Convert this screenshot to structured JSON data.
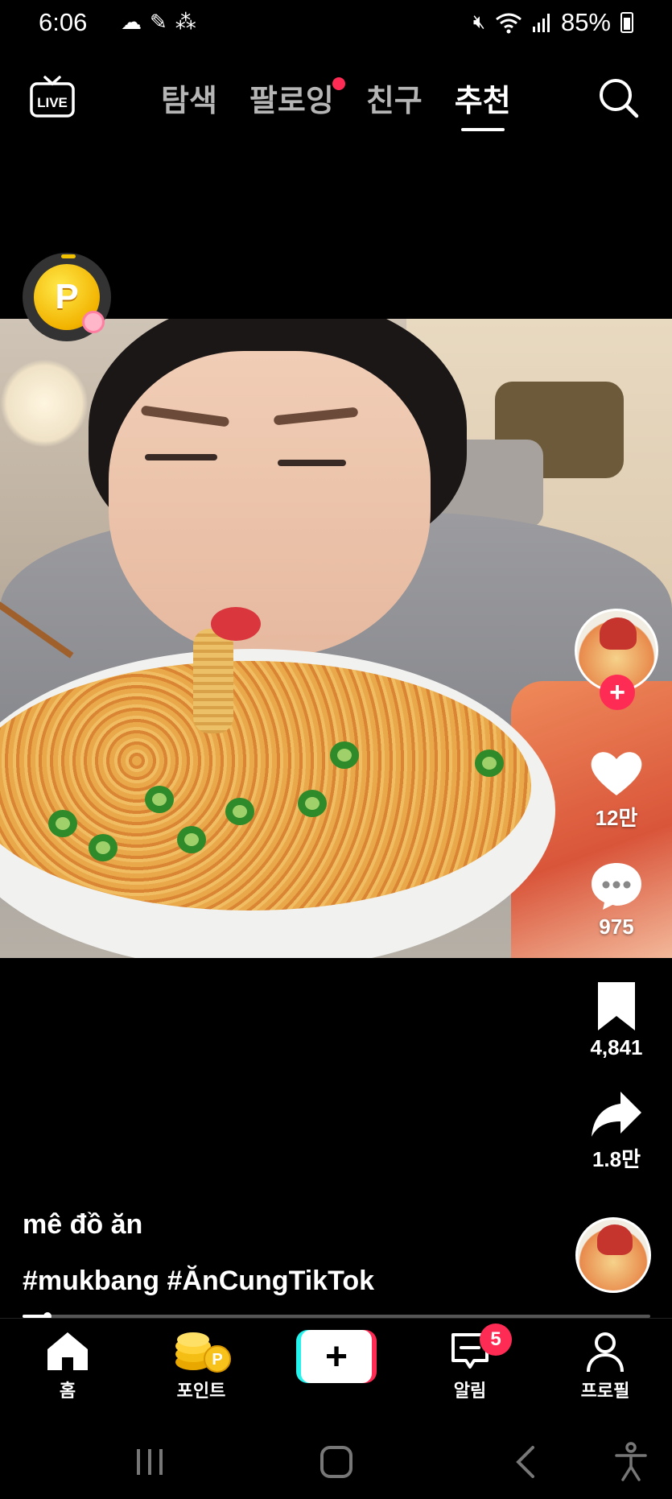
{
  "status": {
    "time": "6:06",
    "battery": "85%"
  },
  "top_nav": {
    "live_label": "LIVE",
    "tabs": [
      {
        "label": "탐색",
        "active": false
      },
      {
        "label": "팔로잉",
        "active": false,
        "dot": true
      },
      {
        "label": "친구",
        "active": false
      },
      {
        "label": "추천",
        "active": true
      }
    ]
  },
  "actions": {
    "likes": "12만",
    "comments": "975",
    "saves": "4,841",
    "shares": "1.8만"
  },
  "caption": {
    "title": "mê đồ ăn",
    "hashtags": "#mukbang #ĂnCungTikTok"
  },
  "progress": {
    "fraction": 0.04
  },
  "bottom_nav": {
    "items": [
      {
        "label": "홈",
        "icon": "home-icon"
      },
      {
        "label": "포인트",
        "icon": "coins-icon"
      },
      {
        "label": "",
        "icon": "plus-icon"
      },
      {
        "label": "알림",
        "icon": "inbox-icon",
        "badge": "5"
      },
      {
        "label": "프로필",
        "icon": "person-icon"
      }
    ]
  },
  "colors": {
    "accent": "#fe2c55",
    "cyan": "#25f4ee"
  }
}
